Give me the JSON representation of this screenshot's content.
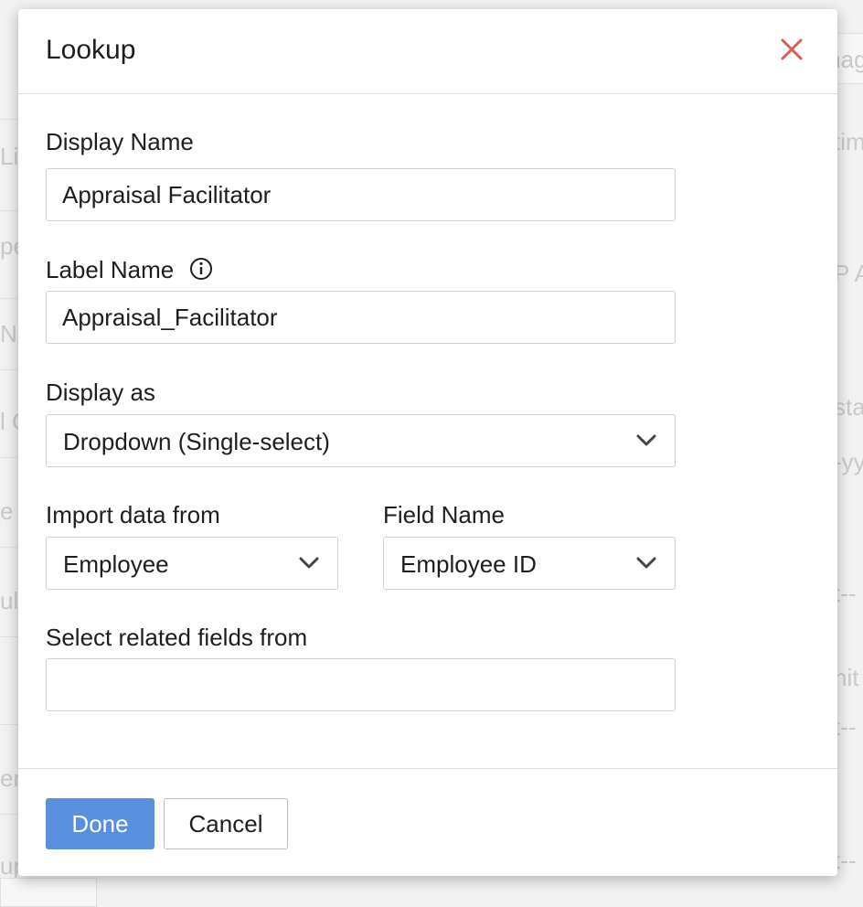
{
  "background": {
    "fragments": [
      "mag",
      "Li",
      "time",
      "pe",
      "P A",
      "No",
      "l C",
      "sta",
      "-yy",
      "e",
      "ula",
      "t--",
      "nit",
      "t--",
      "er",
      "t--",
      "up"
    ]
  },
  "dialog": {
    "title": "Lookup",
    "close_icon": "close-icon",
    "display_name": {
      "label": "Display Name",
      "value": "Appraisal Facilitator"
    },
    "label_name": {
      "label": "Label Name",
      "value": "Appraisal_Facilitator",
      "info_icon": "info-icon"
    },
    "display_as": {
      "label": "Display as",
      "value": "Dropdown (Single-select)"
    },
    "import_from": {
      "label": "Import data from",
      "value": "Employee"
    },
    "field_name": {
      "label": "Field Name",
      "value": "Employee ID"
    },
    "related_fields": {
      "label": "Select related fields from",
      "value": ""
    },
    "buttons": {
      "done": "Done",
      "cancel": "Cancel"
    }
  },
  "colors": {
    "primary": "#5a8fdd",
    "close": "#d9604f",
    "border": "#cfcfcf"
  }
}
